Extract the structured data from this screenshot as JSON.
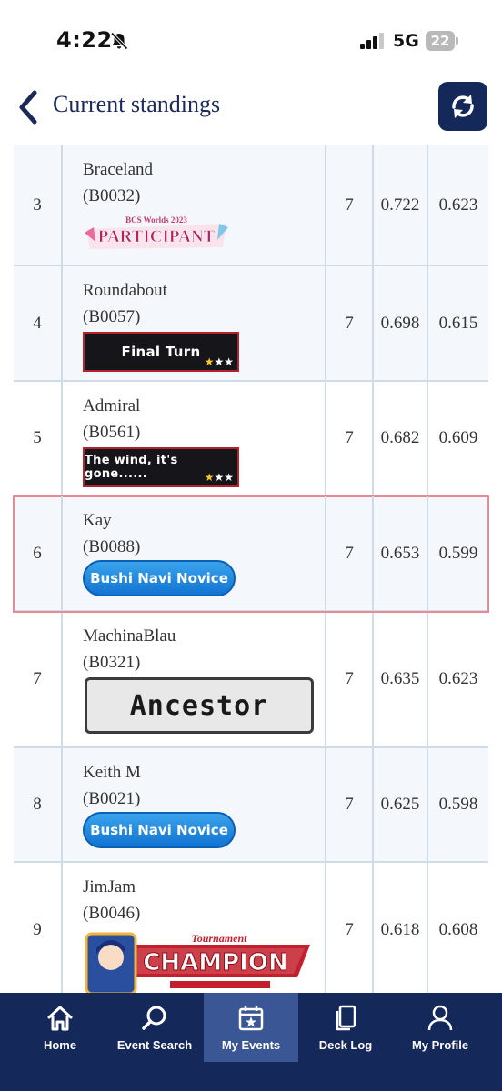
{
  "status_bar": {
    "time": "4:22",
    "network": "5G",
    "battery": "22"
  },
  "header": {
    "title": "Current standings",
    "back_icon": "chevron-left-icon",
    "refresh_icon": "refresh-icon"
  },
  "standings": [
    {
      "rank": "3",
      "name": "Braceland",
      "id": "(B0032)",
      "badge": "BCS Worlds 2023 PARTICIPANT",
      "wins": "7",
      "omw": "0.722",
      "oomw": "0.623"
    },
    {
      "rank": "4",
      "name": "Roundabout",
      "id": "(B0057)",
      "badge": "Final Turn",
      "wins": "7",
      "omw": "0.698",
      "oomw": "0.615"
    },
    {
      "rank": "5",
      "name": "Admiral",
      "id": "(B0561)",
      "badge": "The wind, it's gone......",
      "wins": "7",
      "omw": "0.682",
      "oomw": "0.609"
    },
    {
      "rank": "6",
      "name": "Kay",
      "id": "(B0088)",
      "badge": "Bushi Navi Novice",
      "wins": "7",
      "omw": "0.653",
      "oomw": "0.599"
    },
    {
      "rank": "7",
      "name": "MachinaBlau",
      "id": "(B0321)",
      "badge": "Ancestor",
      "wins": "7",
      "omw": "0.635",
      "oomw": "0.623"
    },
    {
      "rank": "8",
      "name": "Keith M",
      "id": "(B0021)",
      "badge": "Bushi Navi Novice",
      "wins": "7",
      "omw": "0.625",
      "oomw": "0.598"
    },
    {
      "rank": "9",
      "name": "JimJam",
      "id": "(B0046)",
      "badge": "Tournament CHAMPION",
      "wins": "7",
      "omw": "0.618",
      "oomw": "0.608"
    }
  ],
  "badge_text": {
    "participant_top": "BCS Worlds 2023",
    "participant_main": "PARTICIPANT",
    "champion_top": "Tournament",
    "champion_main": "CHAMPION"
  },
  "nav": [
    {
      "label": "Home",
      "icon": "home-icon"
    },
    {
      "label": "Event Search",
      "icon": "search-icon"
    },
    {
      "label": "My Events",
      "icon": "calendar-star-icon",
      "active": true
    },
    {
      "label": "Deck Log",
      "icon": "cards-icon"
    },
    {
      "label": "My Profile",
      "icon": "user-icon"
    }
  ],
  "colors": {
    "navy": "#15285a",
    "nav_active": "#3b5694",
    "highlight_border": "#e88a92",
    "row_alt": "#f4f7fb"
  }
}
